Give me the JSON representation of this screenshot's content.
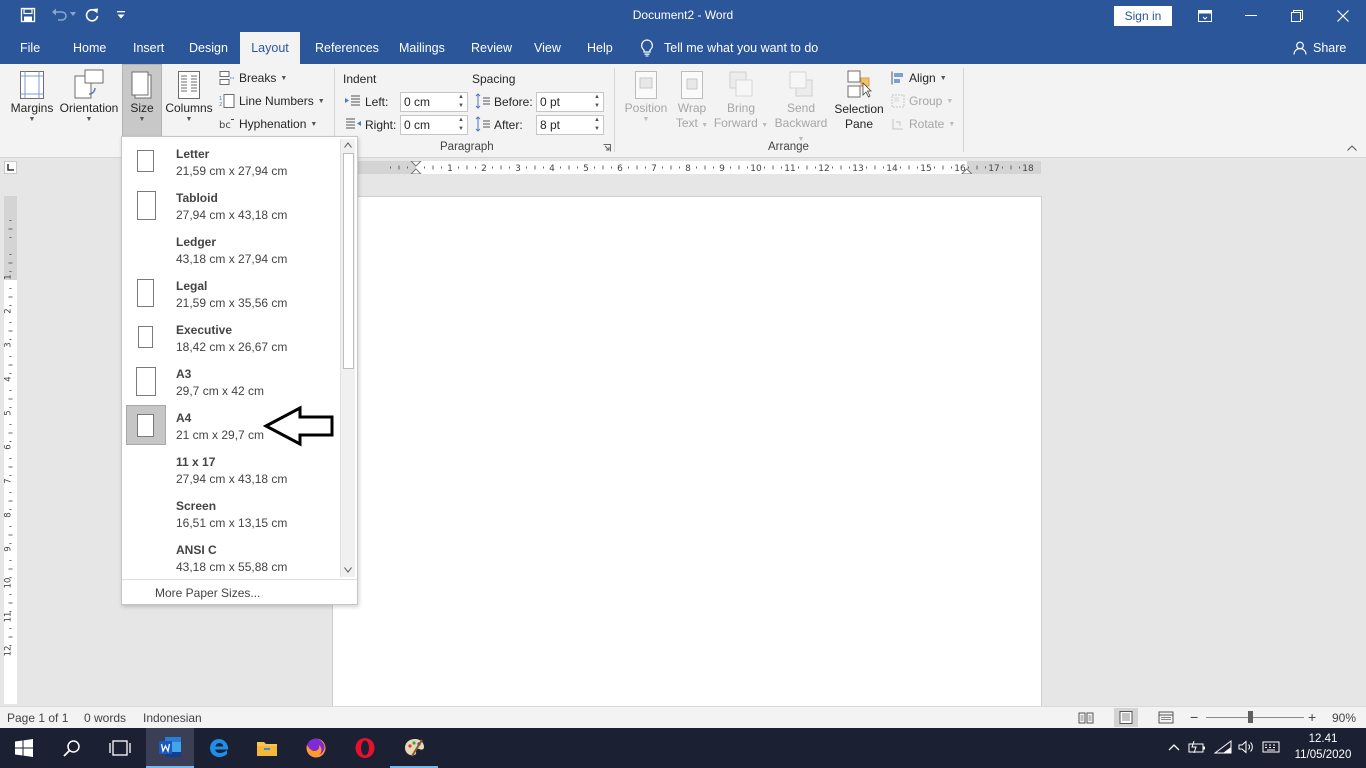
{
  "window": {
    "title": "Document2 - Word",
    "sign_in": "Sign in"
  },
  "tabs": [
    {
      "label": "File"
    },
    {
      "label": "Home"
    },
    {
      "label": "Insert"
    },
    {
      "label": "Design"
    },
    {
      "label": "Layout"
    },
    {
      "label": "References"
    },
    {
      "label": "Mailings"
    },
    {
      "label": "Review"
    },
    {
      "label": "View"
    },
    {
      "label": "Help"
    }
  ],
  "active_tab": "Layout",
  "tell_me": "Tell me what you want to do",
  "share": "Share",
  "ribbon": {
    "page_setup": {
      "margins": "Margins",
      "orientation": "Orientation",
      "size": "Size",
      "columns": "Columns",
      "breaks": "Breaks",
      "line_numbers": "Line Numbers",
      "hyphenation": "Hyphenation"
    },
    "paragraph": {
      "group_label": "Paragraph",
      "indent_label": "Indent",
      "spacing_label": "Spacing",
      "left_label": "Left:",
      "left_value": "0 cm",
      "right_label": "Right:",
      "right_value": "0 cm",
      "before_label": "Before:",
      "before_value": "0 pt",
      "after_label": "After:",
      "after_value": "8 pt"
    },
    "arrange": {
      "group_label": "Arrange",
      "position": "Position",
      "wrap_text_1": "Wrap",
      "wrap_text_2": "Text",
      "bring_forward_1": "Bring",
      "bring_forward_2": "Forward",
      "send_backward_1": "Send",
      "send_backward_2": "Backward",
      "selection_pane_1": "Selection",
      "selection_pane_2": "Pane",
      "align": "Align",
      "group": "Group",
      "rotate": "Rotate"
    }
  },
  "size_dropdown": {
    "items": [
      {
        "name": "Letter",
        "dims": "21,59 cm x 27,94 cm"
      },
      {
        "name": "Tabloid",
        "dims": "27,94 cm x 43,18 cm"
      },
      {
        "name": "Ledger",
        "dims": "43,18 cm x 27,94 cm"
      },
      {
        "name": "Legal",
        "dims": "21,59 cm x 35,56 cm"
      },
      {
        "name": "Executive",
        "dims": "18,42 cm x 26,67 cm"
      },
      {
        "name": "A3",
        "dims": "29,7 cm x 42 cm"
      },
      {
        "name": "A4",
        "dims": "21 cm x 29,7 cm"
      },
      {
        "name": "11 x 17",
        "dims": "27,94 cm x 43,18 cm"
      },
      {
        "name": "Screen",
        "dims": "16,51 cm x 13,15 cm"
      },
      {
        "name": "ANSI C",
        "dims": "43,18 cm x 55,88 cm"
      }
    ],
    "selected": "A4",
    "more": "More Paper Sizes..."
  },
  "ruler": {
    "h_numbers": [
      "1",
      "2",
      "3",
      "4",
      "5",
      "6",
      "7",
      "8",
      "9",
      "10",
      "11",
      "12",
      "13",
      "14",
      "15",
      "16",
      "17",
      "18"
    ],
    "v_numbers": [
      "1",
      "2",
      "3",
      "4",
      "5",
      "6",
      "7",
      "8",
      "9",
      "10",
      "11",
      "12"
    ]
  },
  "status": {
    "page": "Page 1 of 1",
    "words": "0 words",
    "language": "Indonesian",
    "zoom": "90%"
  },
  "taskbar": {
    "time": "12.41",
    "date": "11/05/2020"
  }
}
